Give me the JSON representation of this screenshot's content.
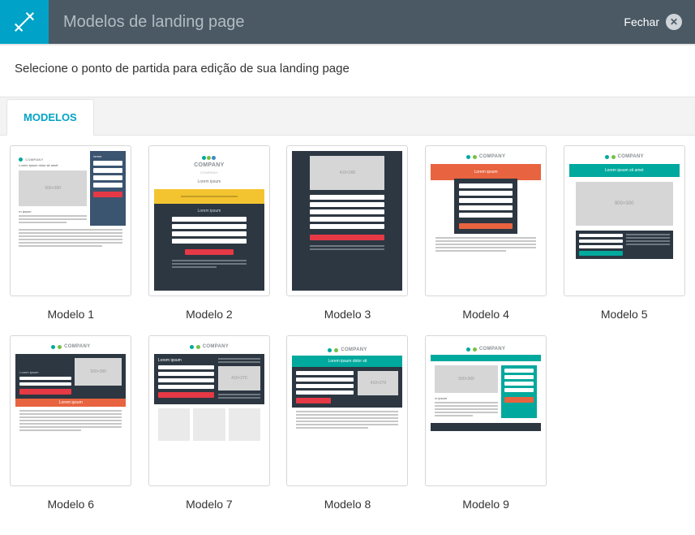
{
  "header": {
    "title": "Modelos de landing page",
    "close_label": "Fechar"
  },
  "subtitle": "Selecione o ponto de partida para edição de sua landing page",
  "tabs": {
    "active": "MODELOS"
  },
  "templates": [
    {
      "label": "Modelo 1",
      "accent": "#3b5470",
      "logo": "COMPANY",
      "lorem": "Lorem ipsum dolor sit amet",
      "ph": "500×300"
    },
    {
      "label": "Modelo 2",
      "accent": "#f4c430",
      "accent2": "#e63946",
      "logo": "COMPANY",
      "sublogo": "COMPANY",
      "lorem": "Lorem ipsum"
    },
    {
      "label": "Modelo 3",
      "accent": "#e63946",
      "ph": "410×280"
    },
    {
      "label": "Modelo 4",
      "accent": "#e8633f",
      "logo": "COMPANY",
      "lorem": "Lorem ipsum"
    },
    {
      "label": "Modelo 5",
      "accent": "#00a99d",
      "logo": "COMPANY",
      "lorem": "Lorem ipsum sit amet",
      "ph": "900×300"
    },
    {
      "label": "Modelo 6",
      "accent": "#e8633f",
      "logo": "COMPANY",
      "lorem": "Lorem ipsum",
      "ph": "500×300"
    },
    {
      "label": "Modelo 7",
      "accent": "#e63946",
      "logo": "COMPANY",
      "lorem": "Lorem ipsum",
      "ph": "410×270"
    },
    {
      "label": "Modelo 8",
      "accent": "#00a99d",
      "logo": "COMPANY",
      "lorem": "Lorem ipsum dolor sit",
      "ph": "410×270"
    },
    {
      "label": "Modelo 9",
      "accent": "#00a99d",
      "logo": "COMPANY",
      "lorem": "m ipsum",
      "ph": "500×300"
    }
  ],
  "thumbnail_text": {
    "company": "COMPANY",
    "company_sub": "COMPANY"
  }
}
